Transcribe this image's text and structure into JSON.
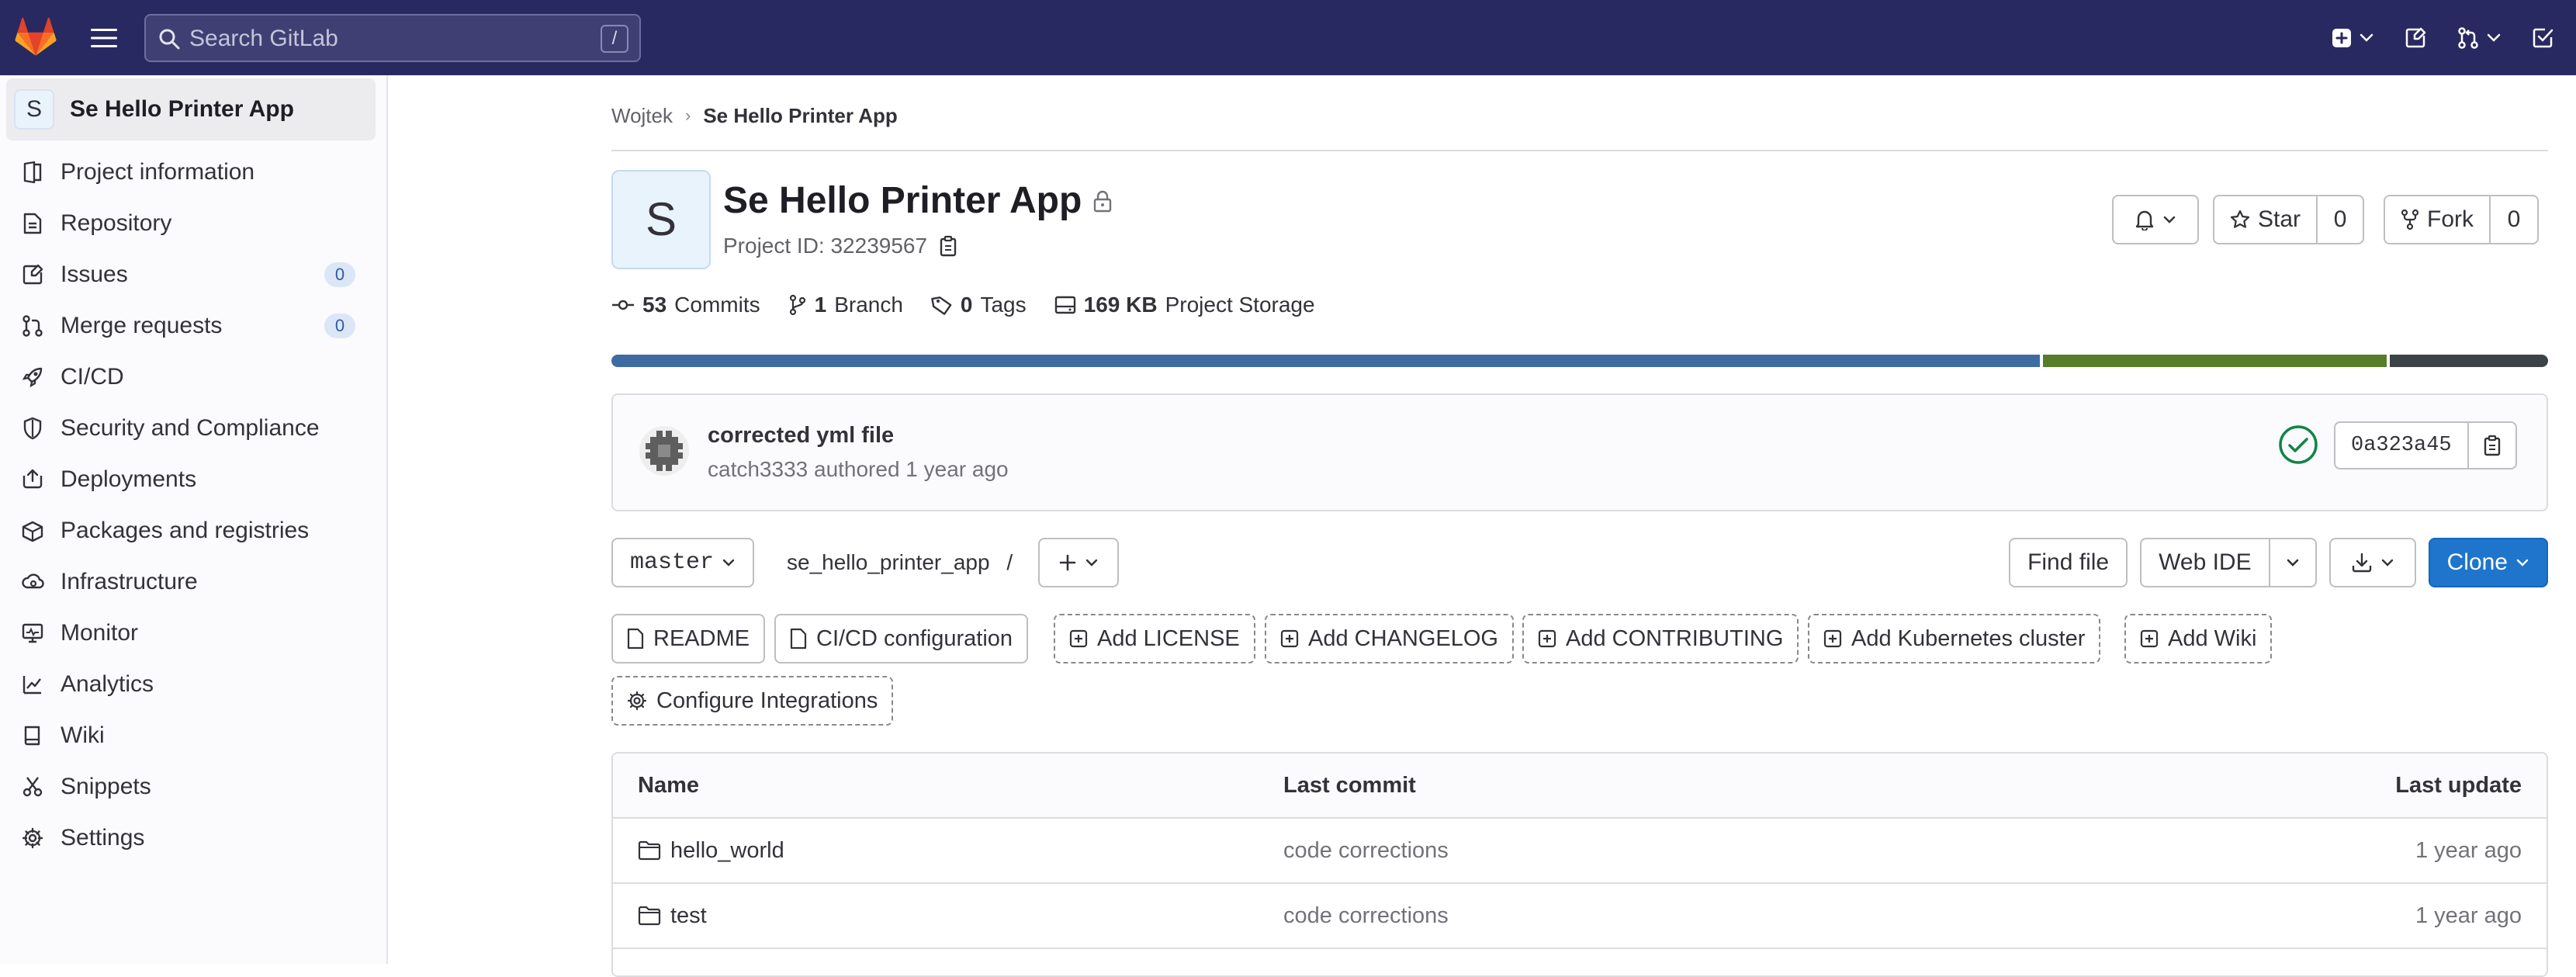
{
  "topbar": {
    "search_placeholder": "Search GitLab",
    "search_shortcut": "/",
    "colors": {
      "background": "#292961",
      "logo_orange": "#e24329"
    }
  },
  "sidebar": {
    "project_avatar_letter": "S",
    "project_name": "Se Hello Printer App",
    "items": [
      {
        "label": "Project information",
        "icon": "project-info-icon"
      },
      {
        "label": "Repository",
        "icon": "document-icon"
      },
      {
        "label": "Issues",
        "icon": "issues-icon",
        "count": "0"
      },
      {
        "label": "Merge requests",
        "icon": "merge-request-icon",
        "count": "0"
      },
      {
        "label": "CI/CD",
        "icon": "rocket-icon"
      },
      {
        "label": "Security and Compliance",
        "icon": "shield-icon"
      },
      {
        "label": "Deployments",
        "icon": "deployments-icon"
      },
      {
        "label": "Packages and registries",
        "icon": "package-icon"
      },
      {
        "label": "Infrastructure",
        "icon": "cloud-gear-icon"
      },
      {
        "label": "Monitor",
        "icon": "monitor-icon"
      },
      {
        "label": "Analytics",
        "icon": "chart-icon"
      },
      {
        "label": "Wiki",
        "icon": "book-icon"
      },
      {
        "label": "Snippets",
        "icon": "scissors-icon"
      },
      {
        "label": "Settings",
        "icon": "gear-icon"
      }
    ]
  },
  "breadcrumb": {
    "parent": "Wojtek",
    "current": "Se Hello Printer App"
  },
  "project": {
    "avatar_letter": "S",
    "title": "Se Hello Printer App",
    "id_label": "Project ID: 32239567",
    "star_label": "Star",
    "star_count": "0",
    "fork_label": "Fork",
    "fork_count": "0"
  },
  "stats": {
    "commits_count": "53",
    "commits_label": "Commits",
    "branch_count": "1",
    "branch_label": "Branch",
    "tags_count": "0",
    "tags_label": "Tags",
    "storage_size": "169 KB",
    "storage_label": "Project Storage"
  },
  "language_bar": [
    {
      "share": 0.74,
      "color": "#3f6ba3"
    },
    {
      "share": 0.178,
      "color": "#567d2a"
    },
    {
      "share": 0.082,
      "color": "#3b4347"
    }
  ],
  "last_commit": {
    "title": "corrected yml file",
    "meta": "catch3333 authored 1 year ago",
    "sha": "0a323a45",
    "status_color": "#108548"
  },
  "tree": {
    "branch": "master",
    "path": "se_hello_printer_app",
    "path_sep": "/",
    "find_file": "Find file",
    "web_ide": "Web IDE",
    "clone": "Clone"
  },
  "shortcuts": [
    {
      "label": "README",
      "style": "solid",
      "icon": "document-icon"
    },
    {
      "label": "CI/CD configuration",
      "style": "solid",
      "icon": "document-icon"
    },
    {
      "label": "Add LICENSE",
      "style": "dashed",
      "icon": "plus-square-icon"
    },
    {
      "label": "Add CHANGELOG",
      "style": "dashed",
      "icon": "plus-square-icon"
    },
    {
      "label": "Add CONTRIBUTING",
      "style": "dashed",
      "icon": "plus-square-icon"
    },
    {
      "label": "Add Kubernetes cluster",
      "style": "dashed",
      "icon": "plus-square-icon"
    },
    {
      "label": "Add Wiki",
      "style": "dashed",
      "icon": "plus-square-icon"
    },
    {
      "label": "Configure Integrations",
      "style": "dashed",
      "icon": "gear-icon"
    }
  ],
  "file_table": {
    "headers": {
      "name": "Name",
      "last_commit": "Last commit",
      "last_update": "Last update"
    },
    "rows": [
      {
        "name": "hello_world",
        "commit": "code corrections",
        "date": "1 year ago"
      },
      {
        "name": "test",
        "commit": "code corrections",
        "date": "1 year ago"
      }
    ]
  }
}
